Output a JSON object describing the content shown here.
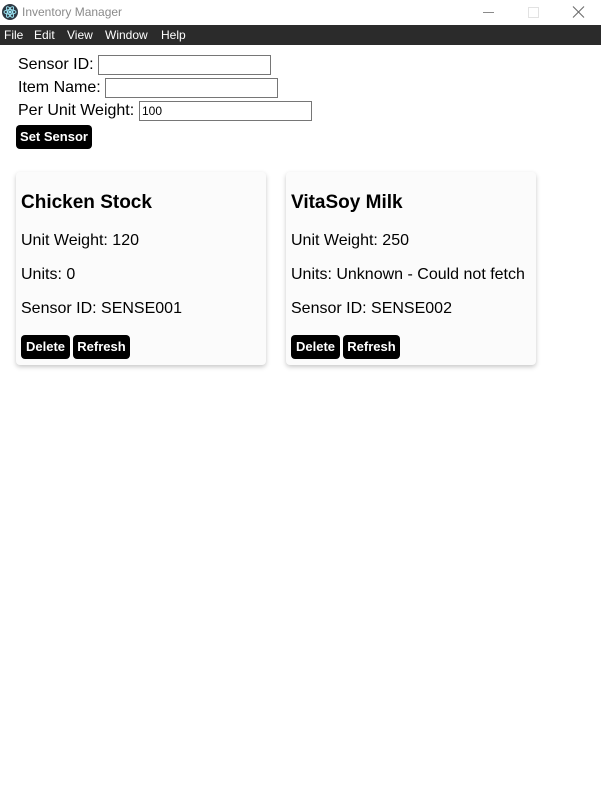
{
  "window": {
    "title": "Inventory Manager"
  },
  "menu": {
    "items": [
      "File",
      "Edit",
      "View",
      "Window",
      "Help"
    ]
  },
  "form": {
    "sensor_id_label": "Sensor ID:",
    "sensor_id_value": "",
    "item_name_label": "Item Name:",
    "item_name_value": "",
    "per_unit_weight_label": "Per Unit Weight:",
    "per_unit_weight_value": "100",
    "set_sensor_label": "Set Sensor"
  },
  "cards": [
    {
      "name": "Chicken Stock",
      "unit_weight": "Unit Weight: 120",
      "units": "Units: 0",
      "sensor_id": "Sensor ID: SENSE001",
      "delete_label": "Delete",
      "refresh_label": "Refresh"
    },
    {
      "name": "VitaSoy Milk",
      "unit_weight": "Unit Weight: 250",
      "units": "Units: Unknown - Could not fetch",
      "sensor_id": "Sensor ID: SENSE002",
      "delete_label": "Delete",
      "refresh_label": "Refresh"
    }
  ],
  "icons": {
    "app": "electron-atom-icon",
    "minimize": "minimize-icon",
    "maximize": "maximize-icon",
    "close": "close-icon"
  },
  "colors": {
    "menubar_bg": "#2b2b2b",
    "button_bg": "#000000",
    "card_bg": "#fbfbfb"
  }
}
